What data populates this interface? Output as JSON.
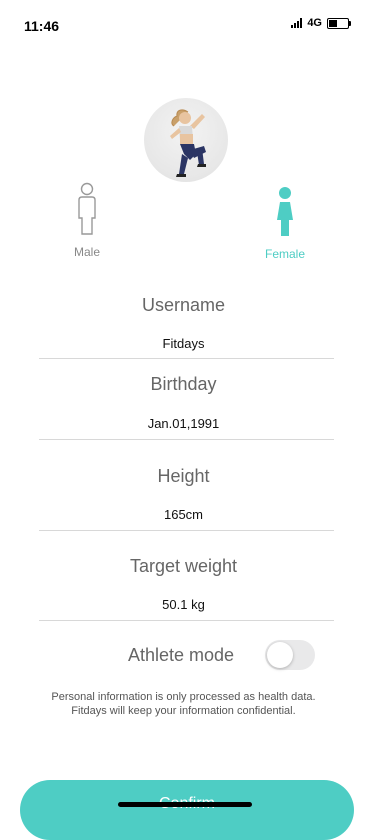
{
  "status_bar": {
    "time": "11:46",
    "network": "4G",
    "battery_level": 0.45
  },
  "profile": {
    "avatar_icon": "fitness-woman-photo"
  },
  "gender": {
    "male_label": "Male",
    "female_label": "Female",
    "selected": "female",
    "accent_color": "#4ecdc4",
    "inactive_color": "#888888"
  },
  "fields": {
    "username": {
      "label": "Username",
      "value": "Fitdays"
    },
    "birthday": {
      "label": "Birthday",
      "value": "Jan.01,1991"
    },
    "height": {
      "label": "Height",
      "value": "165cm"
    },
    "target_weight": {
      "label": "Target weight",
      "value": "50.1 kg"
    }
  },
  "athlete_mode": {
    "label": "Athlete mode",
    "enabled": false
  },
  "disclaimer": "Personal information is only processed as health data. Fitdays will keep your information confidential.",
  "confirm_button": {
    "label": "Confirm",
    "color": "#4ecdc4"
  }
}
